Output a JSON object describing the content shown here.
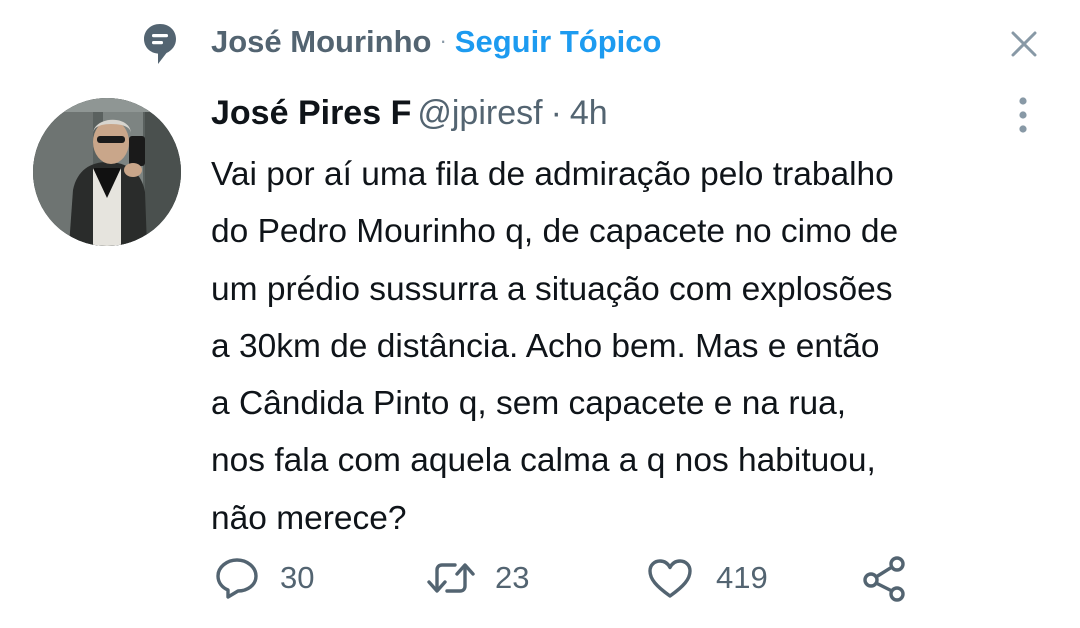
{
  "topic": {
    "name": "José Mourinho",
    "separator": "·",
    "follow_label": "Seguir Tópico"
  },
  "tweet": {
    "author_name": "José Pires F",
    "handle": "@jpiresf",
    "separator": "·",
    "time": "4h",
    "text_lines": [
      "Vai por aí uma fila de admiração pelo trabalho",
      "do Pedro Mourinho q, de capacete no cimo de",
      "um prédio sussurra a situação com explosões",
      "a 30km de distância. Acho bem. Mas e então",
      "a Cândida Pinto q, sem capacete e na rua,",
      "nos fala com aquela calma a q nos habituou,",
      "não merece?"
    ]
  },
  "actions": {
    "replies": "30",
    "retweets": "23",
    "likes": "419"
  },
  "icons": {
    "topic": "topic-icon",
    "close": "close-icon",
    "more": "more-vertical-icon",
    "reply": "reply-icon",
    "retweet": "retweet-icon",
    "like": "like-icon",
    "share": "share-icon"
  },
  "colors": {
    "accent": "#1d9bf0",
    "text": "#0f1419",
    "secondary": "#536471"
  }
}
